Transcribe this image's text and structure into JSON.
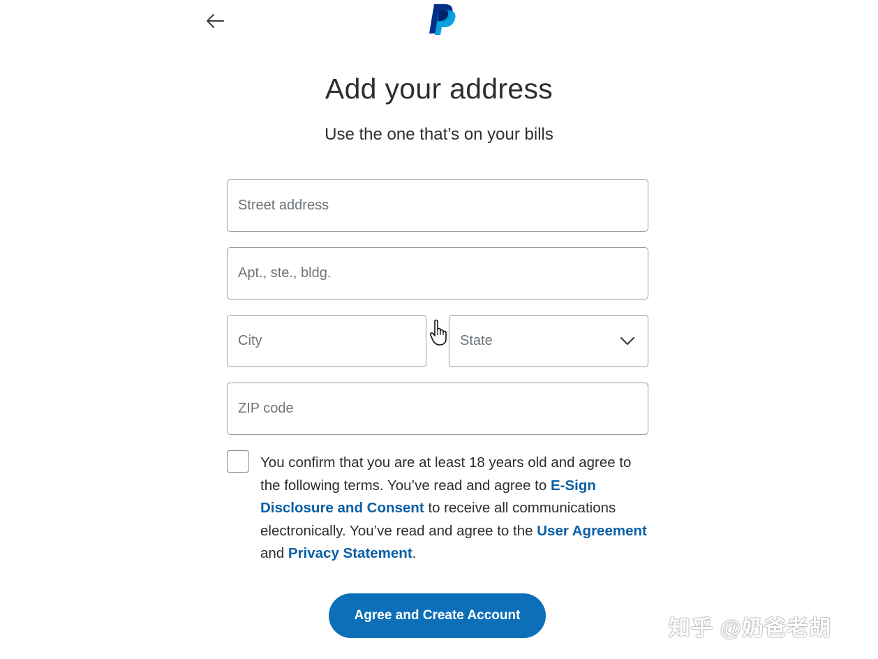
{
  "header": {
    "back_icon": "arrow-left-icon",
    "logo_icon": "paypal-logo-icon",
    "brand_colors": {
      "dark": "#003087",
      "light": "#009cde"
    }
  },
  "main": {
    "title": "Add your address",
    "subtitle": "Use the one that’s on your bills"
  },
  "form": {
    "street": {
      "placeholder": "Street address",
      "value": ""
    },
    "apt": {
      "placeholder": "Apt., ste., bldg.",
      "value": ""
    },
    "city": {
      "placeholder": "City",
      "value": ""
    },
    "state": {
      "selected": "State",
      "icon": "chevron-down-icon"
    },
    "zip": {
      "placeholder": "ZIP code",
      "value": ""
    }
  },
  "terms": {
    "checked": false,
    "text_1": "You confirm that you are at least 18 years old and agree to the following terms. You’ve read and agree to ",
    "link_esign": "E-Sign Disclosure and Consent",
    "text_2": " to receive all communications electronically. You’ve read and agree to the ",
    "link_user_agreement": "User Agreement",
    "text_3": " and ",
    "link_privacy": "Privacy Statement",
    "text_4": ".",
    "link_color": "#0a5fa6"
  },
  "actions": {
    "submit_label": "Agree and Create Account",
    "button_color": "#0d6fb8"
  },
  "overlay": {
    "cursor_icon": "hand-pointer-icon",
    "watermark": "知乎 @奶爸老胡"
  }
}
